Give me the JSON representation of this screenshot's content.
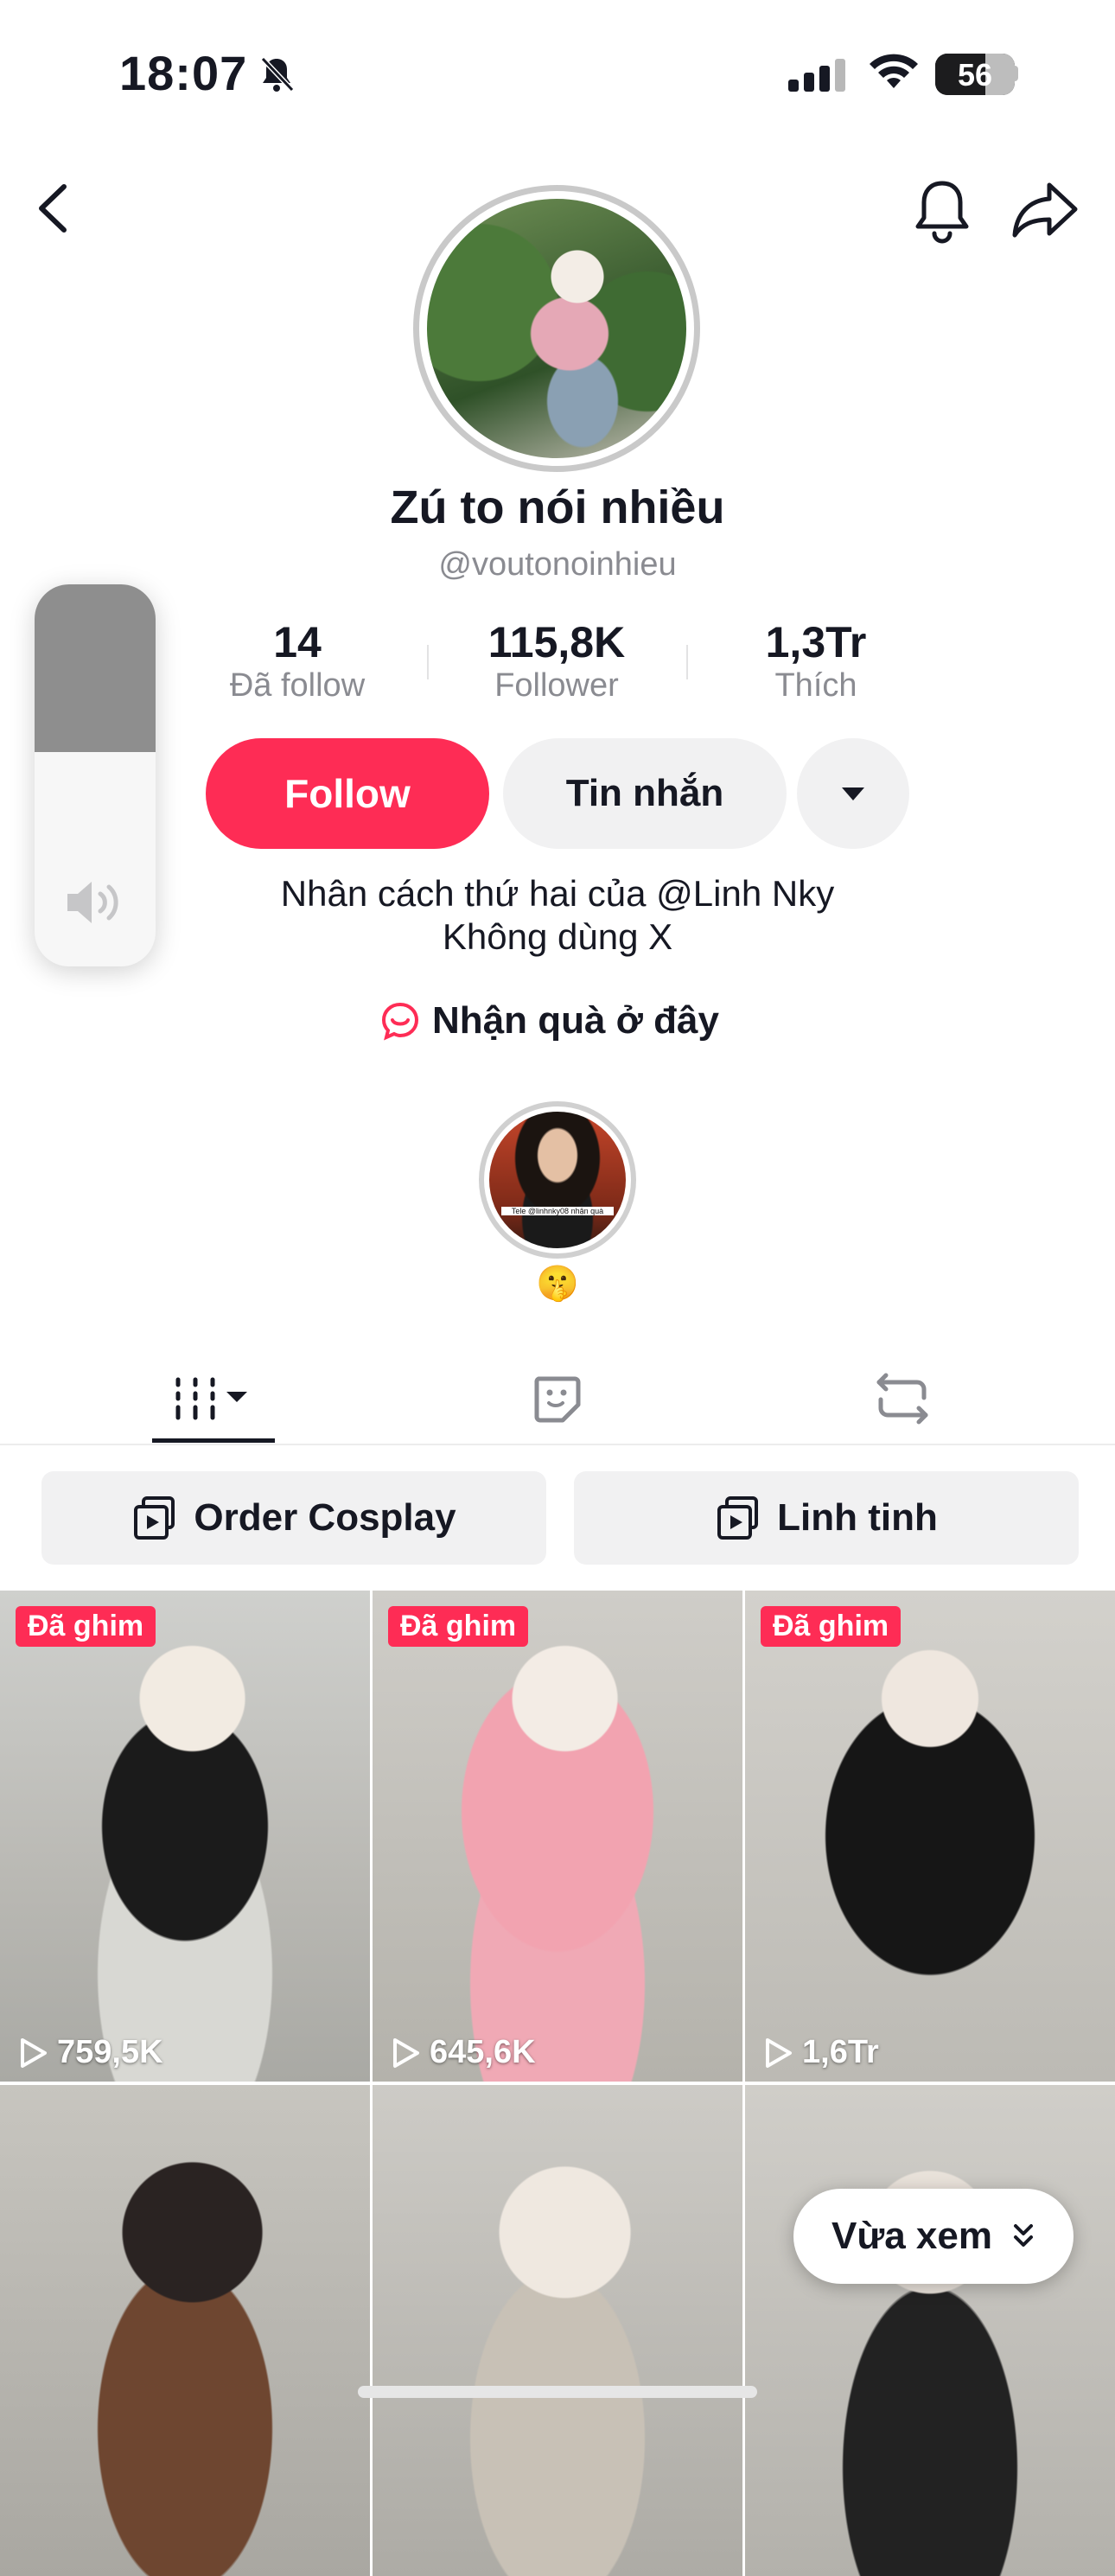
{
  "status_bar": {
    "time": "18:07",
    "battery": "56"
  },
  "profile": {
    "display_name": "Zú to nói nhiều",
    "username": "@voutonoinhieu",
    "stats": [
      {
        "value": "14",
        "label": "Đã follow"
      },
      {
        "value": "115,8K",
        "label": "Follower"
      },
      {
        "value": "1,3Tr",
        "label": "Thích"
      }
    ],
    "follow_label": "Follow",
    "message_label": "Tin nhắn",
    "bio_line1": "Nhân cách thứ hai của @Linh Nky",
    "bio_line2": "Không dùng X",
    "gift_link": "Nhận quà ở đây",
    "highlight_caption": "Tele @linhnky08 nhận quà",
    "highlight_emoji": "🤫"
  },
  "tabs": [
    "videos",
    "stickers",
    "reposts"
  ],
  "playlists": [
    "Order Cosplay",
    "Linh tinh"
  ],
  "videos": [
    {
      "pinned": "Đã ghim",
      "views": "759,5K"
    },
    {
      "pinned": "Đã ghim",
      "views": "645,6K"
    },
    {
      "pinned": "Đã ghim",
      "views": "1,6Tr"
    },
    {
      "pinned": "",
      "views": ""
    },
    {
      "pinned": "",
      "views": ""
    },
    {
      "pinned": "",
      "views": ""
    }
  ],
  "recently_watched": "Vừa xem",
  "volume": {
    "level_percent": 44
  },
  "colors": {
    "accent": "#fe2c55",
    "text": "#161823",
    "muted": "#8a8b91",
    "chip_bg": "#f1f1f2"
  }
}
